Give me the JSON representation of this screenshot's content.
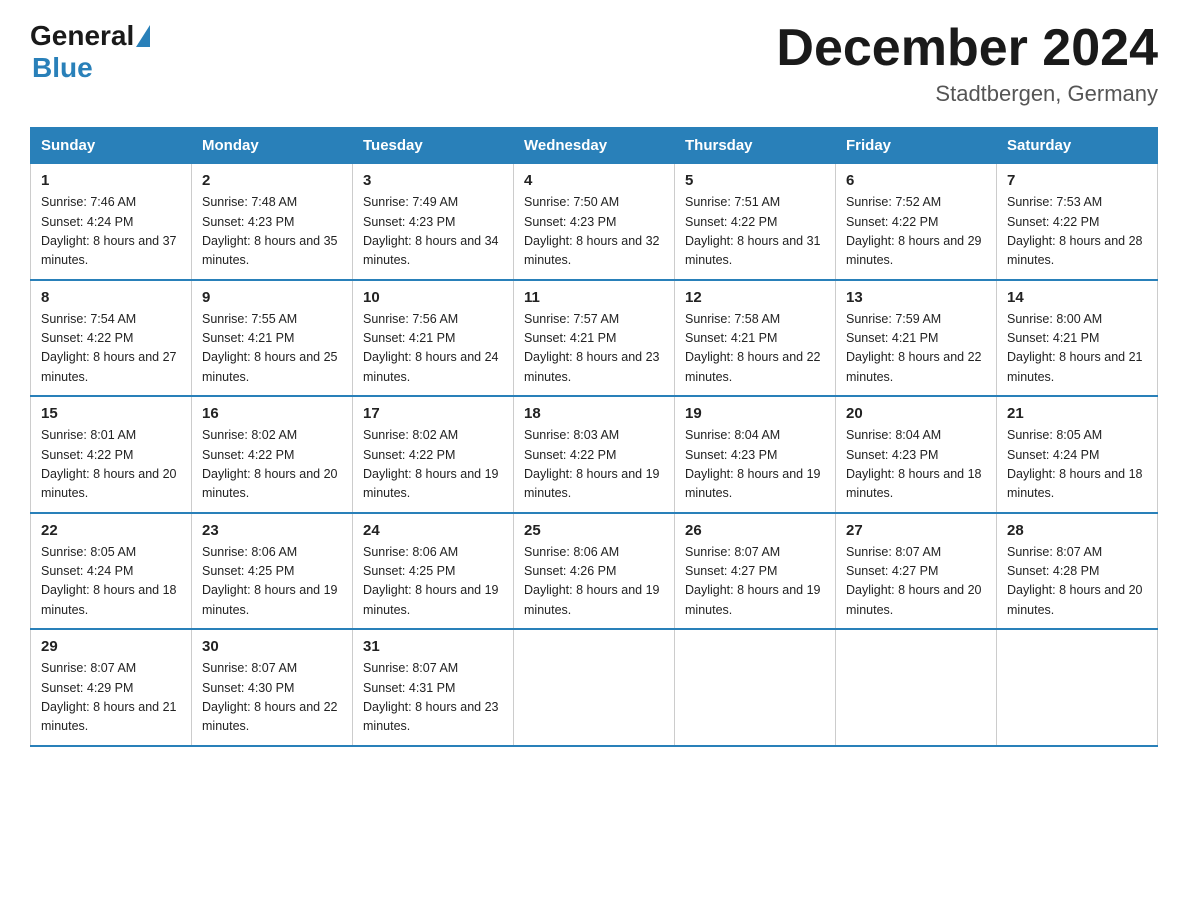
{
  "header": {
    "logo_general": "General",
    "logo_blue": "Blue",
    "month_title": "December 2024",
    "location": "Stadtbergen, Germany"
  },
  "columns": [
    "Sunday",
    "Monday",
    "Tuesday",
    "Wednesday",
    "Thursday",
    "Friday",
    "Saturday"
  ],
  "weeks": [
    [
      {
        "day": "1",
        "sunrise": "7:46 AM",
        "sunset": "4:24 PM",
        "daylight": "8 hours and 37 minutes."
      },
      {
        "day": "2",
        "sunrise": "7:48 AM",
        "sunset": "4:23 PM",
        "daylight": "8 hours and 35 minutes."
      },
      {
        "day": "3",
        "sunrise": "7:49 AM",
        "sunset": "4:23 PM",
        "daylight": "8 hours and 34 minutes."
      },
      {
        "day": "4",
        "sunrise": "7:50 AM",
        "sunset": "4:23 PM",
        "daylight": "8 hours and 32 minutes."
      },
      {
        "day": "5",
        "sunrise": "7:51 AM",
        "sunset": "4:22 PM",
        "daylight": "8 hours and 31 minutes."
      },
      {
        "day": "6",
        "sunrise": "7:52 AM",
        "sunset": "4:22 PM",
        "daylight": "8 hours and 29 minutes."
      },
      {
        "day": "7",
        "sunrise": "7:53 AM",
        "sunset": "4:22 PM",
        "daylight": "8 hours and 28 minutes."
      }
    ],
    [
      {
        "day": "8",
        "sunrise": "7:54 AM",
        "sunset": "4:22 PM",
        "daylight": "8 hours and 27 minutes."
      },
      {
        "day": "9",
        "sunrise": "7:55 AM",
        "sunset": "4:21 PM",
        "daylight": "8 hours and 25 minutes."
      },
      {
        "day": "10",
        "sunrise": "7:56 AM",
        "sunset": "4:21 PM",
        "daylight": "8 hours and 24 minutes."
      },
      {
        "day": "11",
        "sunrise": "7:57 AM",
        "sunset": "4:21 PM",
        "daylight": "8 hours and 23 minutes."
      },
      {
        "day": "12",
        "sunrise": "7:58 AM",
        "sunset": "4:21 PM",
        "daylight": "8 hours and 22 minutes."
      },
      {
        "day": "13",
        "sunrise": "7:59 AM",
        "sunset": "4:21 PM",
        "daylight": "8 hours and 22 minutes."
      },
      {
        "day": "14",
        "sunrise": "8:00 AM",
        "sunset": "4:21 PM",
        "daylight": "8 hours and 21 minutes."
      }
    ],
    [
      {
        "day": "15",
        "sunrise": "8:01 AM",
        "sunset": "4:22 PM",
        "daylight": "8 hours and 20 minutes."
      },
      {
        "day": "16",
        "sunrise": "8:02 AM",
        "sunset": "4:22 PM",
        "daylight": "8 hours and 20 minutes."
      },
      {
        "day": "17",
        "sunrise": "8:02 AM",
        "sunset": "4:22 PM",
        "daylight": "8 hours and 19 minutes."
      },
      {
        "day": "18",
        "sunrise": "8:03 AM",
        "sunset": "4:22 PM",
        "daylight": "8 hours and 19 minutes."
      },
      {
        "day": "19",
        "sunrise": "8:04 AM",
        "sunset": "4:23 PM",
        "daylight": "8 hours and 19 minutes."
      },
      {
        "day": "20",
        "sunrise": "8:04 AM",
        "sunset": "4:23 PM",
        "daylight": "8 hours and 18 minutes."
      },
      {
        "day": "21",
        "sunrise": "8:05 AM",
        "sunset": "4:24 PM",
        "daylight": "8 hours and 18 minutes."
      }
    ],
    [
      {
        "day": "22",
        "sunrise": "8:05 AM",
        "sunset": "4:24 PM",
        "daylight": "8 hours and 18 minutes."
      },
      {
        "day": "23",
        "sunrise": "8:06 AM",
        "sunset": "4:25 PM",
        "daylight": "8 hours and 19 minutes."
      },
      {
        "day": "24",
        "sunrise": "8:06 AM",
        "sunset": "4:25 PM",
        "daylight": "8 hours and 19 minutes."
      },
      {
        "day": "25",
        "sunrise": "8:06 AM",
        "sunset": "4:26 PM",
        "daylight": "8 hours and 19 minutes."
      },
      {
        "day": "26",
        "sunrise": "8:07 AM",
        "sunset": "4:27 PM",
        "daylight": "8 hours and 19 minutes."
      },
      {
        "day": "27",
        "sunrise": "8:07 AM",
        "sunset": "4:27 PM",
        "daylight": "8 hours and 20 minutes."
      },
      {
        "day": "28",
        "sunrise": "8:07 AM",
        "sunset": "4:28 PM",
        "daylight": "8 hours and 20 minutes."
      }
    ],
    [
      {
        "day": "29",
        "sunrise": "8:07 AM",
        "sunset": "4:29 PM",
        "daylight": "8 hours and 21 minutes."
      },
      {
        "day": "30",
        "sunrise": "8:07 AM",
        "sunset": "4:30 PM",
        "daylight": "8 hours and 22 minutes."
      },
      {
        "day": "31",
        "sunrise": "8:07 AM",
        "sunset": "4:31 PM",
        "daylight": "8 hours and 23 minutes."
      },
      null,
      null,
      null,
      null
    ]
  ]
}
